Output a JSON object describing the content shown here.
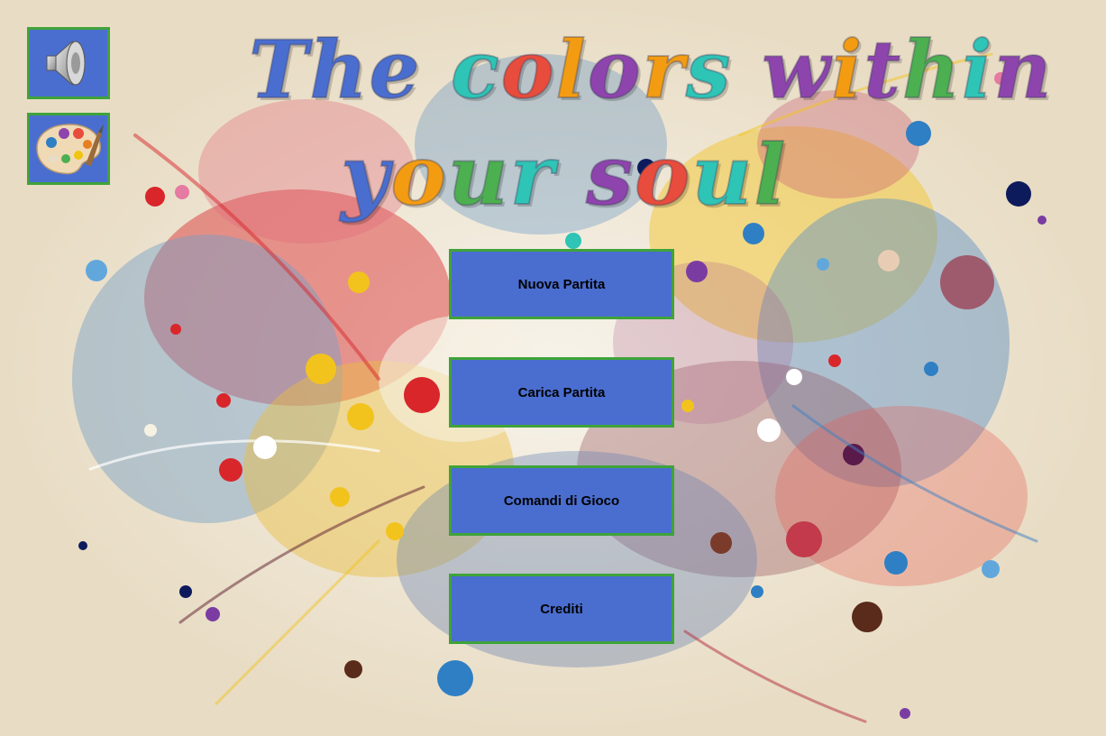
{
  "title": {
    "line1": [
      {
        "text": "The",
        "color": "#4a6ecf"
      },
      {
        "text": " ",
        "color": "#000000"
      },
      {
        "text": "c",
        "color": "#2ec4b6"
      },
      {
        "text": "o",
        "color": "#e74c3c"
      },
      {
        "text": "l",
        "color": "#f39c12"
      },
      {
        "text": "o",
        "color": "#8e44ad"
      },
      {
        "text": "r",
        "color": "#f39c12"
      },
      {
        "text": "s",
        "color": "#2ec4b6"
      },
      {
        "text": " ",
        "color": "#000000"
      },
      {
        "text": "w",
        "color": "#8e44ad"
      },
      {
        "text": "i",
        "color": "#f39c12"
      },
      {
        "text": "t",
        "color": "#8e44ad"
      },
      {
        "text": "h",
        "color": "#4caf50"
      },
      {
        "text": "i",
        "color": "#2ec4b6"
      },
      {
        "text": "n",
        "color": "#8e44ad"
      }
    ],
    "line2": [
      {
        "text": "y",
        "color": "#4a6ecf"
      },
      {
        "text": "o",
        "color": "#f39c12"
      },
      {
        "text": "u",
        "color": "#4caf50"
      },
      {
        "text": "r",
        "color": "#2ec4b6"
      },
      {
        "text": " ",
        "color": "#000000"
      },
      {
        "text": "s",
        "color": "#8e44ad"
      },
      {
        "text": "o",
        "color": "#e74c3c"
      },
      {
        "text": "u",
        "color": "#2ec4b6"
      },
      {
        "text": "l",
        "color": "#4caf50"
      }
    ]
  },
  "side_buttons": {
    "sound_icon": "speaker-icon",
    "palette_icon": "palette-icon"
  },
  "menu": {
    "new_game": "Nuova Partita",
    "load_game": "Carica Partita",
    "controls": "Comandi di Gioco",
    "credits": "Crediti"
  },
  "colors": {
    "button_fill": "#4a6ecf",
    "button_border": "#3fa33a",
    "background": "#e8dcc4"
  }
}
